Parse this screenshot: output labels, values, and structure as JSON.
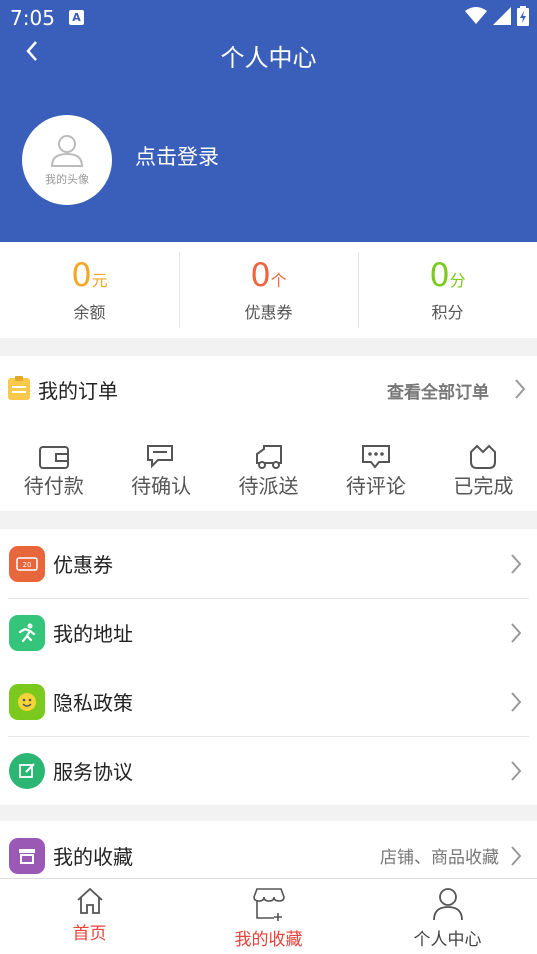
{
  "status": {
    "time": "7:05",
    "badge": "A"
  },
  "header": {
    "title": "个人中心",
    "avatar_label": "我的头像",
    "login_text": "点击登录"
  },
  "stats": [
    {
      "value": "0",
      "unit": "元",
      "label": "余额",
      "color": "#f5a623"
    },
    {
      "value": "0",
      "unit": "个",
      "label": "优惠券",
      "color": "#f0653c"
    },
    {
      "value": "0",
      "unit": "分",
      "label": "积分",
      "color": "#7bc91f"
    }
  ],
  "orders": {
    "title": "我的订单",
    "view_all": "查看全部订单",
    "tabs": [
      {
        "label": "待付款",
        "icon": "wallet-icon"
      },
      {
        "label": "待确认",
        "icon": "message-icon"
      },
      {
        "label": "待派送",
        "icon": "truck-icon"
      },
      {
        "label": "待评论",
        "icon": "comment-icon"
      },
      {
        "label": "已完成",
        "icon": "shirt-icon"
      }
    ]
  },
  "menu": [
    {
      "label": "优惠券",
      "icon": "coupon-icon",
      "color": "#e8663c"
    },
    {
      "label": "我的地址",
      "icon": "runner-icon",
      "color": "#34c47a"
    },
    {
      "label": "隐私政策",
      "icon": "smile-icon",
      "color": "#7bc91f"
    },
    {
      "label": "服务协议",
      "icon": "edit-icon",
      "color": "#2bb673"
    },
    {
      "label": "我的收藏",
      "icon": "store-icon",
      "color": "#9b59b6",
      "extra": "店铺、商品收藏"
    }
  ],
  "tabbar": [
    {
      "label": "首页",
      "icon": "home-icon",
      "active": true
    },
    {
      "label": "我的收藏",
      "icon": "shop-icon",
      "active": true
    },
    {
      "label": "个人中心",
      "icon": "person-icon",
      "active": false
    }
  ]
}
